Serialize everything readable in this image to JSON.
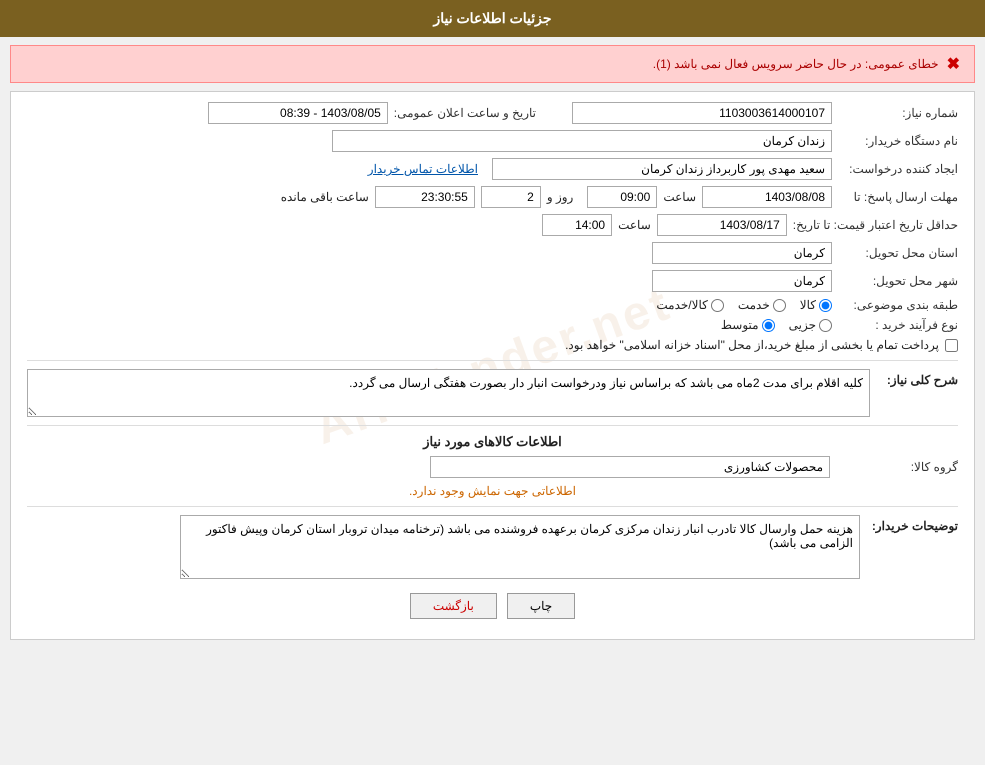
{
  "header": {
    "title": "جزئیات اطلاعات نیاز"
  },
  "error": {
    "icon": "✖",
    "message": "خطای عمومی: در حال حاضر سرویس فعال نمی باشد (1)."
  },
  "form": {
    "shomareNiaz_label": "شماره نیاز:",
    "shomareNiaz_value": "1103003614000107",
    "tarikh_label": "تاریخ و ساعت اعلان عمومی:",
    "tarikh_value": "1403/08/05 - 08:39",
    "namDastgah_label": "نام دستگاه خریدار:",
    "namDastgah_value": "زندان کرمان",
    "ijad_label": "ایجاد کننده درخواست:",
    "ijad_value": "سعید مهدی پور کاربرداز زندان کرمان",
    "ettelaat_link": "اطلاعات تماس خریدار",
    "mohlatErsalPasokh_label": "مهلت ارسال پاسخ: تا",
    "mohlatErsalPasokh_date": "1403/08/08",
    "mohlatErsalPasokh_time": "09:00",
    "mohlatErsalPasokh_roz": "2",
    "mohlatErsalPasokh_saatBaqi": "23:30:55",
    "roz_label": "روز و",
    "saatBaqi_label": "ساعت باقی مانده",
    "hadaqalTarikh_label": "حداقل تاریخ اعتبار قیمت: تا تاریخ:",
    "hadaqalTarikh_date": "1403/08/17",
    "hadaqalTarikh_time": "14:00",
    "ostanTahvil_label": "استان محل تحویل:",
    "ostanTahvil_value": "کرمان",
    "shahrTahvil_label": "شهر محل تحویل:",
    "shahrTahvil_value": "کرمان",
    "tabaghebandi_label": "طبقه بندی موضوعی:",
    "tabaghebandi_kala": "کالا",
    "tabaghebandi_khedmat": "خدمت",
    "tabaghebandi_kalaKhedmat": "کالا/خدمت",
    "tabaghebandi_selected": "kala",
    "noeFarayand_label": "نوع فرآیند خرید :",
    "noeFarayand_jezee": "جزیی",
    "noeFarayand_motavaset": "متوسط",
    "noeFarayand_selected": "motavaset",
    "pardakht_label": "پرداخت تمام یا بخشی از مبلغ خرید،از محل \"اسناد خزانه اسلامی\" خواهد بود.",
    "pardakht_checked": false,
    "sharh_label": "شرح کلی نیاز:",
    "sharh_value": "کلیه اقلام برای مدت 2ماه می باشد که براساس نیاز ودرخواست انبار دار بصورت هفتگی ارسال می گردد.",
    "kalaInfo_title": "اطلاعات کالاهای مورد نیاز",
    "groupKala_label": "گروه کالا:",
    "groupKala_value": "محصولات کشاورزی",
    "noInfo_msg": "اطلاعاتی جهت نمایش وجود ندارد.",
    "tazihaat_label": "توضیحات خریدار:",
    "tazihaat_value": "هزینه حمل وارسال کالا تادرب انبار زندان مرکزی کرمان برعهده فروشنده می باشد (ترخنامه میدان تروبار استان کرمان وپیش فاکتور الزامی می باشد)"
  },
  "buttons": {
    "print": "چاپ",
    "back": "بازگشت"
  },
  "watermark": "AriaTender.net"
}
